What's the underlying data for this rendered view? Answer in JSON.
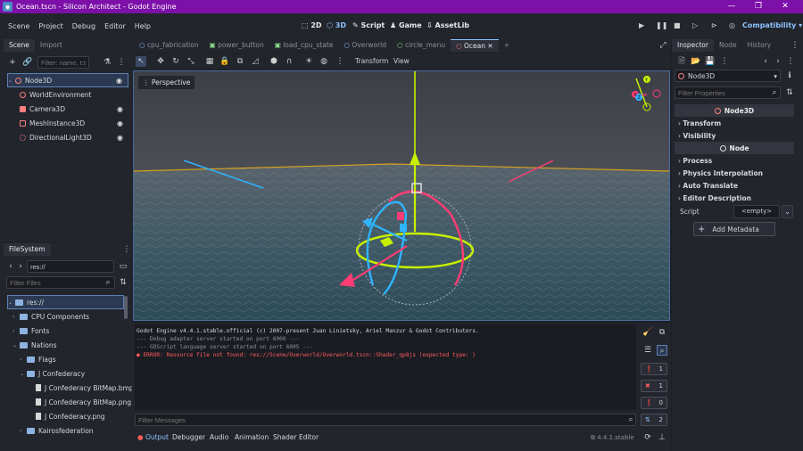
{
  "window": {
    "title": "Ocean.tscn - Silicon Architect - Godot Engine",
    "controls": {
      "minimize": "—",
      "maximize": "❐",
      "close": "✕"
    }
  },
  "menu": [
    "Scene",
    "Project",
    "Debug",
    "Editor",
    "Help"
  ],
  "workspaces": [
    {
      "label": "2D",
      "icon": "2d-icon"
    },
    {
      "label": "3D",
      "icon": "3d-icon"
    },
    {
      "label": "Script",
      "icon": "script-icon"
    },
    {
      "label": "Game",
      "icon": "game-icon"
    },
    {
      "label": "AssetLib",
      "icon": "assetlib-icon"
    }
  ],
  "renderer": "Compatibility",
  "scene_dock": {
    "tabs": [
      "Scene",
      "Import"
    ],
    "filter_placeholder": "Filter: name, t:ty",
    "nodes": [
      {
        "name": "Node3D"
      },
      {
        "name": "WorldEnvironment"
      },
      {
        "name": "Camera3D"
      },
      {
        "name": "MeshInstance3D"
      },
      {
        "name": "DirectionalLight3D"
      }
    ]
  },
  "editor_tabs": [
    "cpu_fabrication",
    "power_button",
    "load_cpu_state",
    "Overworld",
    "circle_menu",
    "Ocean"
  ],
  "viewport": {
    "menus": [
      "Transform",
      "View"
    ],
    "perspective_label": "Perspective",
    "gizmo_labels": {
      "x": "X",
      "y": "Y",
      "z": "Z"
    }
  },
  "filesystem": {
    "title": "FileSystem",
    "path": "res://",
    "filter_placeholder": "Filter Files",
    "items": [
      {
        "label": "res://"
      },
      {
        "label": "CPU Components"
      },
      {
        "label": "Fonts"
      },
      {
        "label": "Nations"
      },
      {
        "label": "Flags"
      },
      {
        "label": "J Confederacy"
      },
      {
        "label": "J Confederacy BitMap.bmp"
      },
      {
        "label": "J Confederacy BitMap.png"
      },
      {
        "label": "J Confederacy.png"
      },
      {
        "label": "Kairosfederation"
      }
    ]
  },
  "console": {
    "lines": [
      "Godot Engine v4.4.1.stable.official (c) 2007-present Juan Linietsky, Ariel Manzur & Godot Contributors.",
      "--- Debug adapter server started on port 6006 ---",
      "--- GDScript language server started on port 6005 ---",
      "● ERROR: Resource file not found: res://Scene/Overworld/Overworld.tscn::Shader_qp8js (expected type: )"
    ],
    "filter_placeholder": "Filter Messages",
    "counts": {
      "messages": "1",
      "errors": "1",
      "warnings": "0",
      "editor": "2"
    }
  },
  "bottom_tabs": [
    "Output",
    "Debugger",
    "Audio",
    "Animation",
    "Shader Editor"
  ],
  "version": "4.4.1.stable",
  "inspector": {
    "tabs": [
      "Inspector",
      "Node",
      "History"
    ],
    "selected_node": "Node3D",
    "filter_placeholder": "Filter Properties",
    "header_node3d": "Node3D",
    "sections_node3d": [
      "Transform",
      "Visibility"
    ],
    "header_node": "Node",
    "sections_node": [
      "Process",
      "Physics Interpolation",
      "Auto Translate",
      "Editor Description"
    ],
    "script_label": "Script",
    "script_value": "<empty>",
    "add_metadata": "Add Metadata"
  },
  "colors": {
    "titlebar": "#7c10a8",
    "accent": "#8ec2ff",
    "error": "#ff5d5d",
    "gizmo_x": "#ff3c74",
    "gizmo_y": "#c8f000",
    "gizmo_z": "#2fb4ff"
  }
}
